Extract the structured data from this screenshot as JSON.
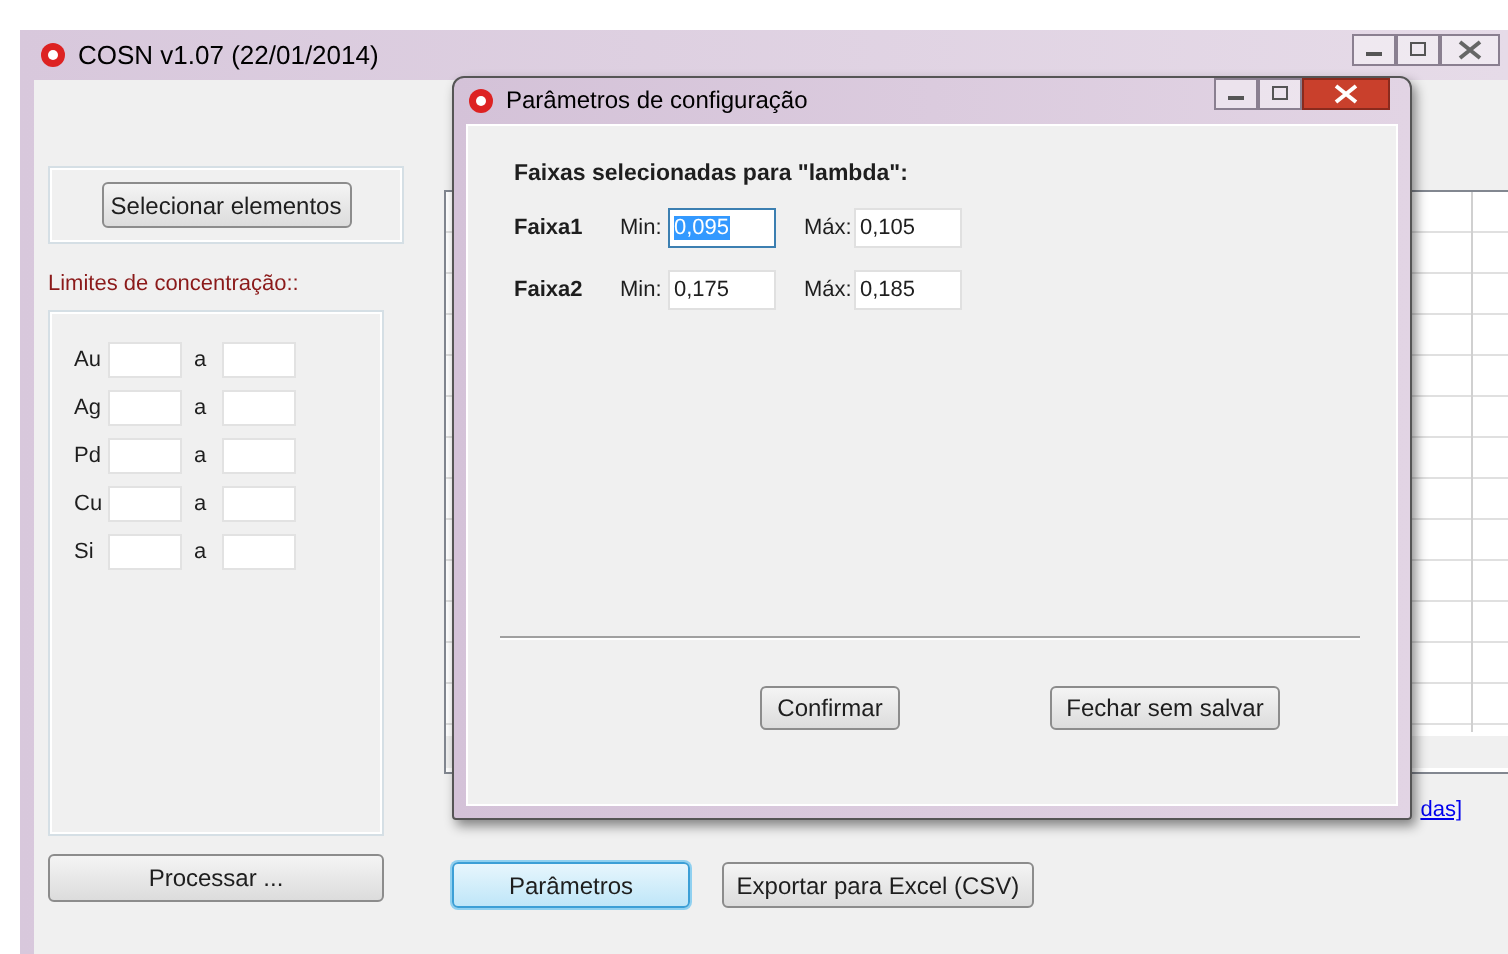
{
  "main_window": {
    "title": "COSN v1.07 (22/01/2014)",
    "select_button": "Selecionar elementos",
    "limits_label": "Limites de concentração::",
    "limits": [
      {
        "element": "Au",
        "separator": "a"
      },
      {
        "element": "Ag",
        "separator": "a"
      },
      {
        "element": "Pd",
        "separator": "a"
      },
      {
        "element": "Cu",
        "separator": "a"
      },
      {
        "element": "Si",
        "separator": "a"
      }
    ],
    "process_button": "Processar ...",
    "link": "das]",
    "buttons": [
      {
        "label": "Parâmetros",
        "focused": true
      },
      {
        "label": "Exportar para Excel (CSV)",
        "focused": false
      }
    ]
  },
  "dialog": {
    "title": "Parâmetros de configuração",
    "heading": "Faixas selecionadas para \"lambda\":",
    "ranges": [
      {
        "name": "Faixa1",
        "min_label": "Min:",
        "min": "0,095",
        "min_selected": true,
        "max_label": "Máx:",
        "max": "0,105"
      },
      {
        "name": "Faixa2",
        "min_label": "Min:",
        "min": "0,175",
        "min_selected": false,
        "max_label": "Máx:",
        "max": "0,185"
      }
    ],
    "buttons": [
      "Confirmar",
      "Fechar sem salvar"
    ]
  }
}
